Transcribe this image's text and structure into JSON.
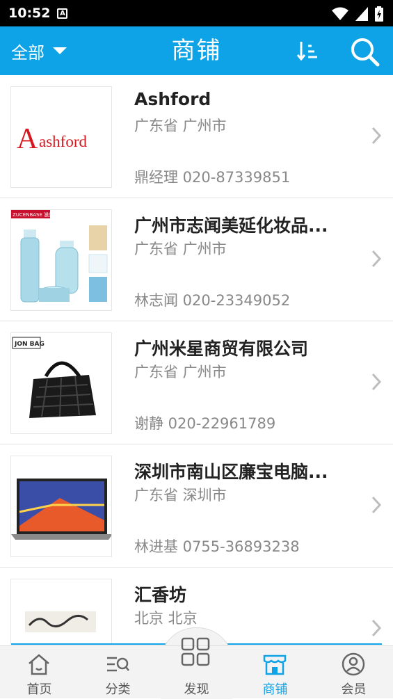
{
  "status_bar": {
    "time": "10:52",
    "notification_letter": "A"
  },
  "app_bar": {
    "filter_label": "全部",
    "title": "商铺",
    "sort_icon": "sort-icon",
    "search_icon": "search-icon"
  },
  "shops": [
    {
      "name": "Ashford",
      "location": "广东省 广州市",
      "contact": "鼎经理 020-87339851",
      "logo_text": "ashford",
      "logo_initial": "A"
    },
    {
      "name": "广州市志闻美延化妆品...",
      "location": "广东省 广州市",
      "contact": "林志闻 020-23349052",
      "logo_text": "ZUCENBASE 滋贝"
    },
    {
      "name": "广州米星商贸有限公司",
      "location": "广东省 广州市",
      "contact": "谢静 020-22961789",
      "logo_text": "JON BAG"
    },
    {
      "name": "深圳市南山区廉宝电脑...",
      "location": "广东省 深圳市",
      "contact": "林进基 0755-36893238"
    },
    {
      "name": "汇香坊",
      "location": "北京 北京",
      "contact": ""
    }
  ],
  "tabs": [
    {
      "label": "首页",
      "icon": "home-icon"
    },
    {
      "label": "分类",
      "icon": "category-icon"
    },
    {
      "label": "发现",
      "icon": "discover-grid-icon"
    },
    {
      "label": "商铺",
      "icon": "shop-icon",
      "active": true
    },
    {
      "label": "会员",
      "icon": "member-icon"
    }
  ],
  "colors": {
    "accent": "#0ea3e6",
    "ashford_red": "#d7161e"
  }
}
